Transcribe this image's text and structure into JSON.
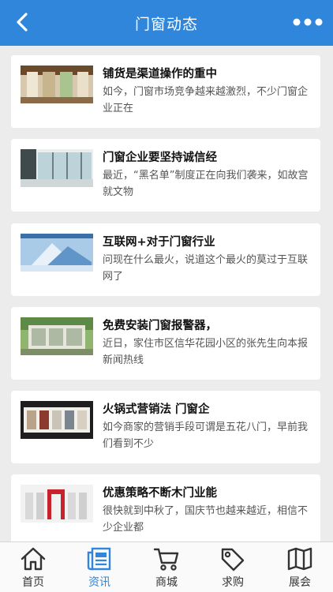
{
  "header": {
    "title": "门窗动态",
    "back_icon": "chevron-left-icon",
    "more_icon": "more-dots-icon"
  },
  "articles": [
    {
      "title": "铺货是渠道操作的重中",
      "summary": "如今，门窗市场竞争越来越激烈，不少门窗企业正在"
    },
    {
      "title": "门窗企业要坚持诚信经",
      "summary": "最近，“黑名单”制度正在向我们袭来，如故宫就文物"
    },
    {
      "title": "互联网+对于门窗行业",
      "summary": "问现在什么最火，说道这个最火的莫过于互联网了"
    },
    {
      "title": "免费安装门窗报警器，",
      "summary": "近日，家住市区信华花园小区的张先生向本报新闻热线"
    },
    {
      "title": "火锅式营销法 门窗企",
      "summary": "如今商家的营销手段可谓是五花八门，早前我们看到不少"
    },
    {
      "title": "优惠策略不断木门业能",
      "summary": "很快就到中秋了，国庆节也越来越近，相信不少企业都"
    }
  ],
  "tabbar": {
    "items": [
      {
        "label": "首页",
        "icon": "home-icon"
      },
      {
        "label": "资讯",
        "icon": "news-icon",
        "active": true
      },
      {
        "label": "商城",
        "icon": "cart-icon"
      },
      {
        "label": "求购",
        "icon": "tag-icon"
      },
      {
        "label": "展会",
        "icon": "map-icon"
      }
    ]
  },
  "colors": {
    "primary": "#2f86db",
    "background": "#ececec"
  }
}
